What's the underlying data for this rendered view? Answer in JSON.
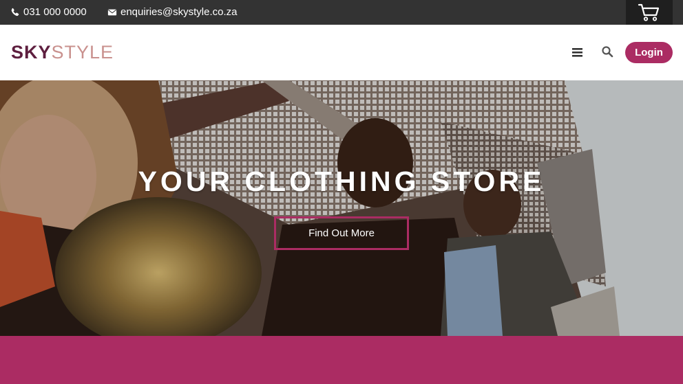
{
  "topbar": {
    "phone": "031 000 0000",
    "email": "enquiries@skystyle.co.za",
    "phone_icon": "phone-icon",
    "email_icon": "envelope-icon",
    "cart_icon": "cart-icon"
  },
  "header": {
    "logo_sky": "SKY",
    "logo_style": "STYLE",
    "menu_icon": "hamburger-menu-icon",
    "search_icon": "search-icon",
    "login_label": "Login"
  },
  "hero": {
    "title": "YOUR CLOTHING STORE",
    "cta_label": "Find Out More"
  },
  "colors": {
    "topbar_bg": "#333333",
    "brand_dark": "#5e1f3f",
    "brand_light": "#c9918e",
    "accent": "#ab2c63"
  }
}
